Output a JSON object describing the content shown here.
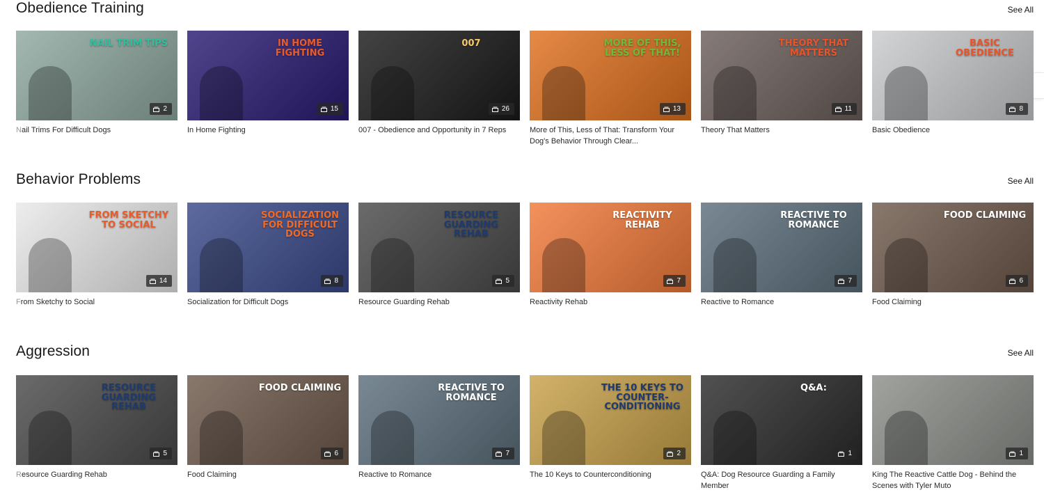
{
  "sections": [
    {
      "title": "Obedience Training",
      "see_all": "See All",
      "cards": [
        {
          "title": "Nail Trims For Difficult Dogs",
          "count": "2",
          "overlay": "NAIL TRIM TIPS",
          "bg": "#8fa9a0",
          "accent": "#2fbf9d"
        },
        {
          "title": "In Home Fighting",
          "count": "15",
          "overlay": "IN HOME FIGHTING",
          "bg": "#2a1b73",
          "accent": "#e85b2a"
        },
        {
          "title": "007 - Obedience and Opportunity in 7 Reps",
          "count": "26",
          "overlay": "007",
          "bg": "#1a1a1a",
          "accent": "#f5c96a"
        },
        {
          "title": "More of This, Less of That: Transform Your Dog's Behavior Through Clear...",
          "count": "13",
          "overlay": "MORE OF THIS, LESS OF THAT!",
          "bg": "#e0701e",
          "accent": "#6fb83a"
        },
        {
          "title": "Theory That Matters",
          "count": "11",
          "overlay": "THEORY THAT MATTERS",
          "bg": "#6b5e5a",
          "accent": "#e8542a"
        },
        {
          "title": "Basic Obedience",
          "count": "8",
          "overlay": "BASIC OBEDIENCE",
          "bg": "#c9cbcd",
          "accent": "#e8542a"
        }
      ]
    },
    {
      "title": "Behavior Problems",
      "see_all": "See All",
      "cards": [
        {
          "title": "From Sketchy to Social",
          "count": "14",
          "overlay": "FROM SKETCHY TO SOCIAL",
          "bg": "#e9e9e9",
          "accent": "#e85b2a"
        },
        {
          "title": "Socialization for Difficult Dogs",
          "count": "8",
          "overlay": "SOCIALIZATION FOR DIFFICULT DOGS",
          "bg": "#3a4a8a",
          "accent": "#f06a25"
        },
        {
          "title": "Resource Guarding Rehab",
          "count": "5",
          "overlay": "RESOURCE GUARDING REHAB",
          "bg": "#4a4a4a",
          "accent": "#1e3a6e"
        },
        {
          "title": "Reactivity Rehab",
          "count": "7",
          "overlay": "REACTIVITY REHAB",
          "bg": "#f27a3a",
          "accent": "#ffffff"
        },
        {
          "title": "Reactive to Romance",
          "count": "7",
          "overlay": "REACTIVE TO ROMANCE",
          "bg": "#5c6f7c",
          "accent": "#ffffff"
        },
        {
          "title": "Food Claiming",
          "count": "6",
          "overlay": "FOOD CLAIMING",
          "bg": "#6f5a4c",
          "accent": "#ffffff"
        }
      ]
    },
    {
      "title": "Aggression",
      "see_all": "See All",
      "cards": [
        {
          "title": "Resource Guarding Rehab",
          "count": "5",
          "overlay": "RESOURCE GUARDING REHAB",
          "bg": "#4a4a4a",
          "accent": "#1e3a6e"
        },
        {
          "title": "Food Claiming",
          "count": "6",
          "overlay": "FOOD CLAIMING",
          "bg": "#6f5a4c",
          "accent": "#ffffff"
        },
        {
          "title": "Reactive to Romance",
          "count": "7",
          "overlay": "REACTIVE TO ROMANCE",
          "bg": "#5c6f7c",
          "accent": "#ffffff"
        },
        {
          "title": "The 10 Keys to Counterconditioning",
          "count": "2",
          "overlay": "THE 10 KEYS TO COUNTER-CONDITIONING",
          "bg": "#c9a24a",
          "accent": "#1e3a6e"
        },
        {
          "title": "Q&A: Dog Resource Guarding a Family Member",
          "count": "1",
          "overlay": "Q&A:",
          "bg": "#2b2b2b",
          "accent": "#ffffff"
        },
        {
          "title": "King The Reactive Cattle Dog - Behind the Scenes with Tyler Muto",
          "count": "1",
          "overlay": "",
          "bg": "#8c8f8a",
          "accent": "#ffffff"
        }
      ]
    }
  ]
}
